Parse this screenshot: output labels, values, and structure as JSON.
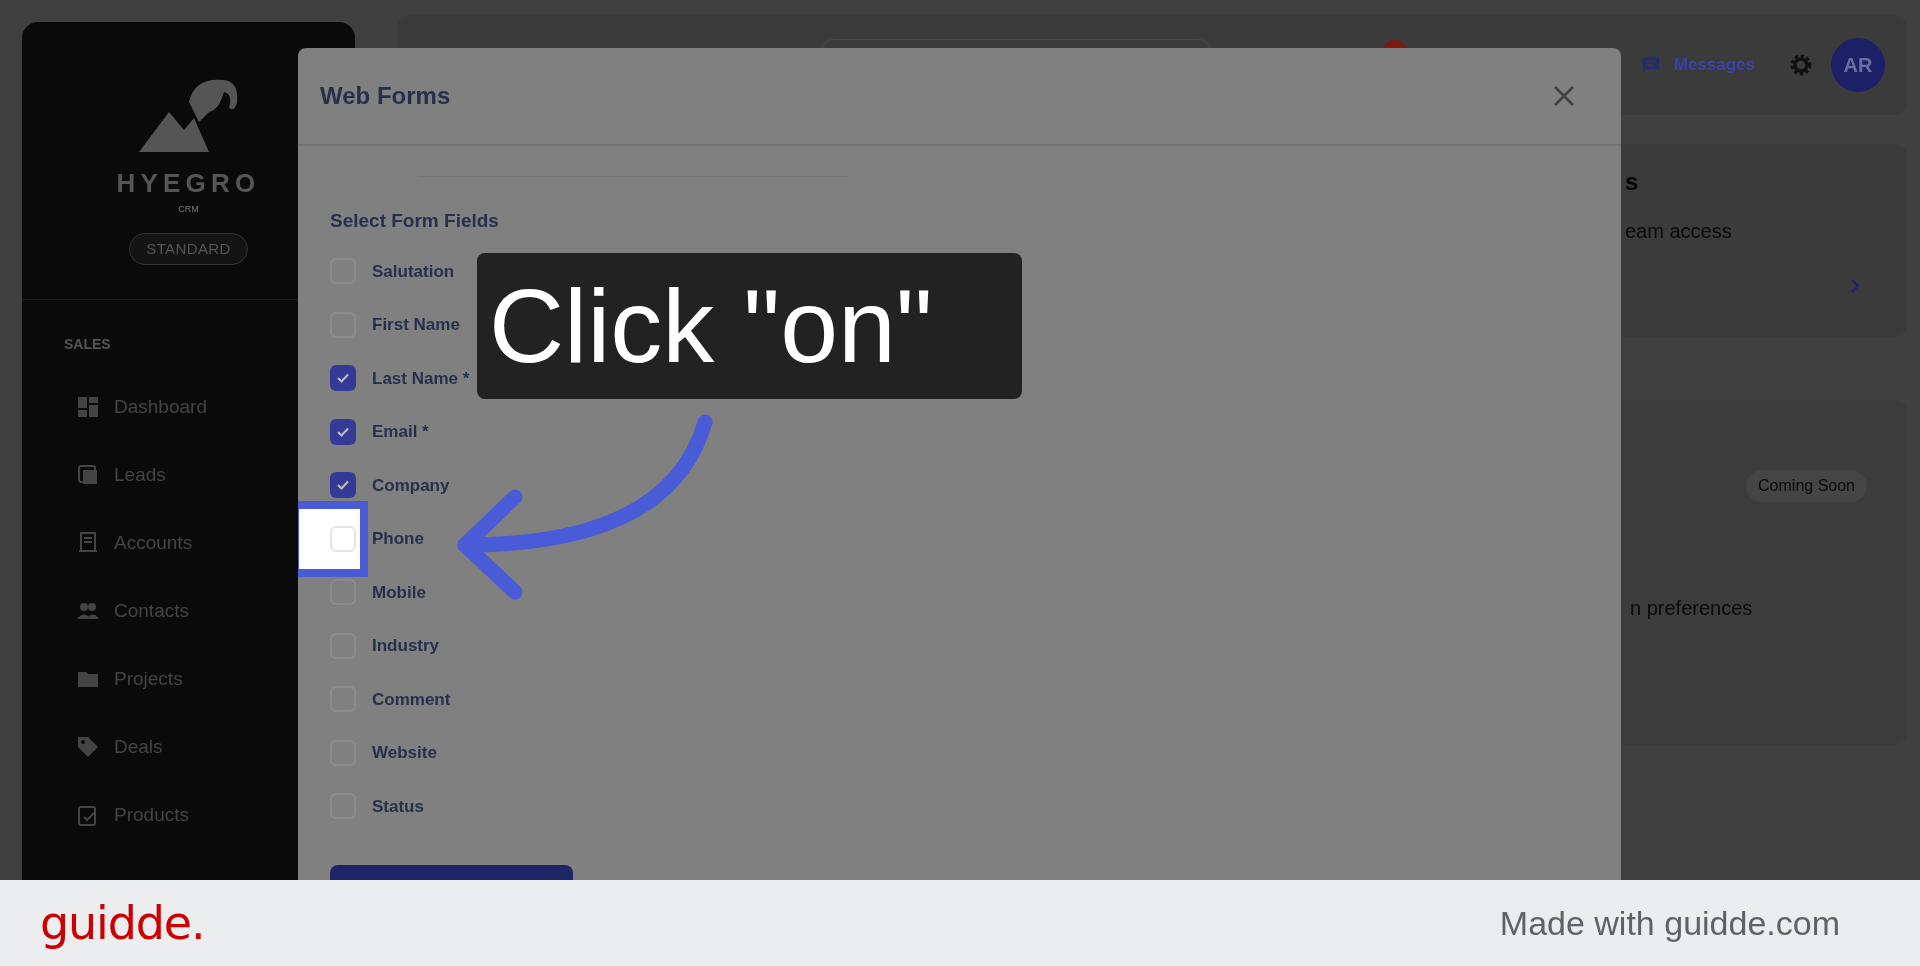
{
  "sidebar": {
    "brand": "HYEGRO",
    "brand_sub": "CRM",
    "plan": "STANDARD",
    "section": "SALES",
    "items": [
      {
        "label": "Dashboard"
      },
      {
        "label": "Leads"
      },
      {
        "label": "Accounts"
      },
      {
        "label": "Contacts"
      },
      {
        "label": "Projects"
      },
      {
        "label": "Deals"
      },
      {
        "label": "Products"
      }
    ]
  },
  "header": {
    "messages": "Messages",
    "avatar": "AR"
  },
  "background_cards": [
    {
      "title": "s",
      "text": "eam access"
    },
    {
      "badge": "Coming Soon",
      "text": "n preferences"
    }
  ],
  "modal": {
    "title": "Web Forms",
    "section": "Select Form Fields",
    "fields": [
      {
        "label": "Salutation",
        "checked": false,
        "highlighted": false
      },
      {
        "label": "First Name",
        "checked": false,
        "highlighted": false
      },
      {
        "label": "Last Name *",
        "checked": true,
        "highlighted": false
      },
      {
        "label": "Email *",
        "checked": true,
        "highlighted": false
      },
      {
        "label": "Company",
        "checked": true,
        "highlighted": false
      },
      {
        "label": "Phone",
        "checked": false,
        "highlighted": true
      },
      {
        "label": "Mobile",
        "checked": false,
        "highlighted": false
      },
      {
        "label": "Industry",
        "checked": false,
        "highlighted": false
      },
      {
        "label": "Comment",
        "checked": false,
        "highlighted": false
      },
      {
        "label": "Website",
        "checked": false,
        "highlighted": false
      },
      {
        "label": "Status",
        "checked": false,
        "highlighted": false
      }
    ]
  },
  "tooltip": {
    "text": "Click \"on\""
  },
  "footer": {
    "logo": "guidde.",
    "credit": "Made with guidde.com"
  }
}
